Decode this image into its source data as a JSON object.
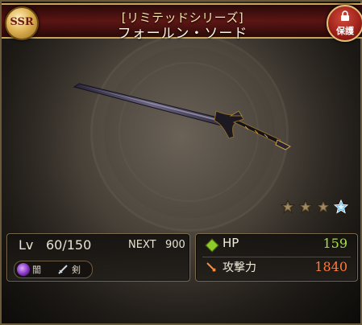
{
  "header": {
    "series": "[リミテッドシリーズ]",
    "weapon_name": "フォールン・ソード",
    "rarity": "SSR",
    "protect_label": "保護"
  },
  "rarity_stars": {
    "filled": 3,
    "blue": 1,
    "total": 4
  },
  "level": {
    "lv_label": "Lv",
    "lv_value": "60/150",
    "next_label": "NEXT",
    "next_value": "900"
  },
  "attributes": {
    "element_label": "闇",
    "weapon_type_label": "剣",
    "element_icon": "dark-element-icon",
    "type_icon": "sword-type-icon"
  },
  "stats": {
    "hp_label": "HP",
    "hp_value": "159",
    "atk_label": "攻撃力",
    "atk_value": "1840"
  },
  "colors": {
    "hp_value": "#a8e04a",
    "atk_value": "#ff7a3a",
    "banner": "#5f1412",
    "gold_trim": "#c9a45a"
  }
}
